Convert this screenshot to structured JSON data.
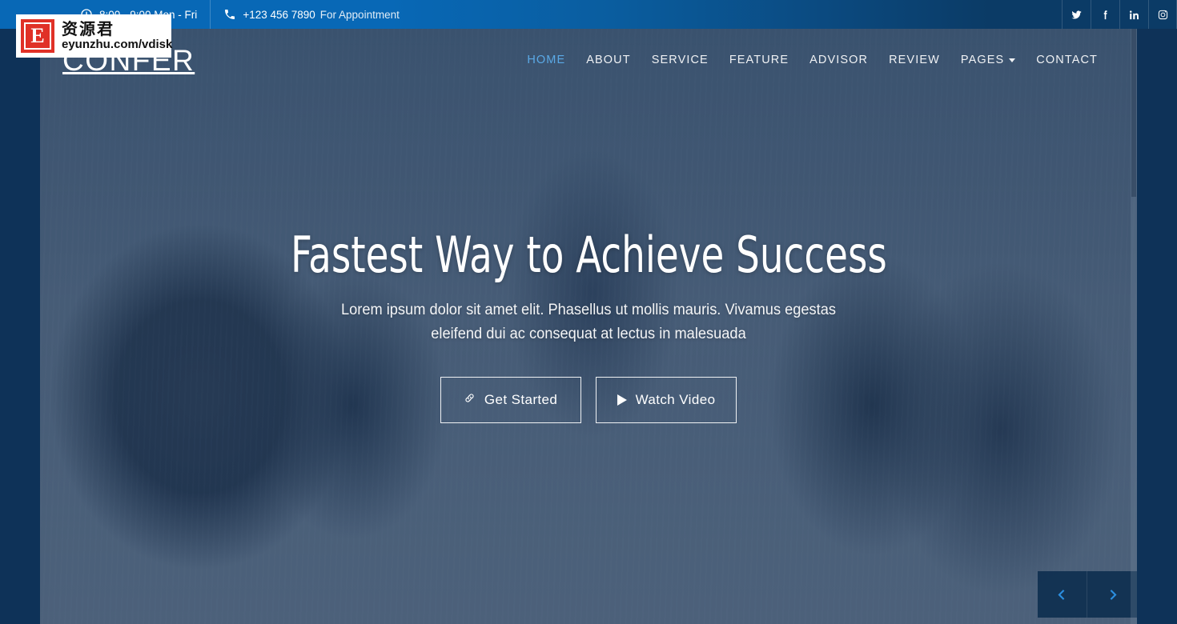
{
  "topbar": {
    "hours": {
      "icon": "clock-icon",
      "text": "8:00 - 9:00 Mon - Fri"
    },
    "phone": {
      "icon": "phone-icon",
      "number": "+123 456 7890",
      "label": "For Appointment"
    },
    "social": [
      {
        "name": "twitter-icon",
        "label": "Twitter"
      },
      {
        "name": "facebook-icon",
        "label": "Facebook"
      },
      {
        "name": "linkedin-icon",
        "label": "LinkedIn"
      },
      {
        "name": "instagram-icon",
        "label": "Instagram"
      }
    ],
    "bg_left": "#0868b6",
    "bg_right": "#0b3b66"
  },
  "navbar": {
    "logo": "CONFER",
    "accent": "#5aa9e6",
    "menu": [
      {
        "label": "HOME",
        "active": true
      },
      {
        "label": "ABOUT",
        "active": false
      },
      {
        "label": "SERVICE",
        "active": false
      },
      {
        "label": "FEATURE",
        "active": false
      },
      {
        "label": "ADVISOR",
        "active": false
      },
      {
        "label": "REVIEW",
        "active": false
      },
      {
        "label": "PAGES",
        "active": false,
        "dropdown": true
      },
      {
        "label": "CONTACT",
        "active": false
      }
    ]
  },
  "hero": {
    "title": "Fastest Way to Achieve Success",
    "subtitle": "Lorem ipsum dolor sit amet elit. Phasellus ut mollis mauris. Vivamus egestas eleifend dui ac consequat at lectus in malesuada",
    "primary_button": {
      "label": "Get Started",
      "icon": "link-chain-icon"
    },
    "secondary_button": {
      "label": "Watch Video",
      "icon": "play-icon"
    },
    "overlay_color": "#183456"
  },
  "carousel": {
    "prev": {
      "name": "chevron-left-icon",
      "label": "Previous slide"
    },
    "next": {
      "name": "chevron-right-icon",
      "label": "Next slide"
    },
    "arrow_color": "#2b8fe0"
  },
  "watermark": {
    "logo_letter": "E",
    "title": "资源君",
    "url": "eyunzhu.com/vdisk",
    "logo_bg": "#e03127"
  }
}
